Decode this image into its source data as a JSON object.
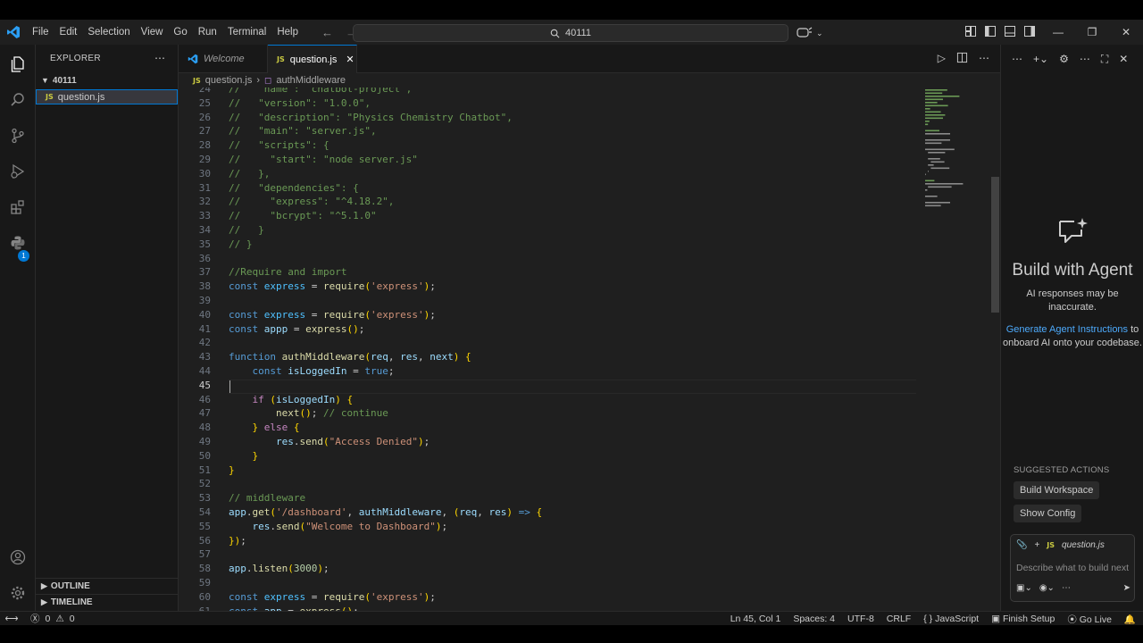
{
  "titlebar": {
    "menu": [
      "File",
      "Edit",
      "Selection",
      "View",
      "Go",
      "Run",
      "Terminal",
      "Help"
    ],
    "search_text": "40111"
  },
  "sidebar": {
    "title": "EXPLORER",
    "folder": "40111",
    "file": "question.js",
    "outline": "OUTLINE",
    "timeline": "TIMELINE",
    "extensions_badge": "1"
  },
  "editor": {
    "tabs": [
      {
        "label": "Welcome",
        "active": false
      },
      {
        "label": "question.js",
        "active": true
      }
    ],
    "breadcrumb": {
      "file": "question.js",
      "symbol": "authMiddleware"
    },
    "cursor_line": 45,
    "lines": [
      {
        "n": 24,
        "text": "//   \"name\": \"chatbot-project\","
      },
      {
        "n": 25,
        "text": "//   \"version\": \"1.0.0\","
      },
      {
        "n": 26,
        "text": "//   \"description\": \"Physics Chemistry Chatbot\","
      },
      {
        "n": 27,
        "text": "//   \"main\": \"server.js\","
      },
      {
        "n": 28,
        "text": "//   \"scripts\": {"
      },
      {
        "n": 29,
        "text": "//     \"start\": \"node server.js\""
      },
      {
        "n": 30,
        "text": "//   },"
      },
      {
        "n": 31,
        "text": "//   \"dependencies\": {"
      },
      {
        "n": 32,
        "text": "//     \"express\": \"^4.18.2\","
      },
      {
        "n": 33,
        "text": "//     \"bcrypt\": \"^5.1.0\""
      },
      {
        "n": 34,
        "text": "//   }"
      },
      {
        "n": 35,
        "text": "// }"
      },
      {
        "n": 36,
        "text": ""
      },
      {
        "n": 37,
        "text": "//Require and import"
      },
      {
        "n": 38,
        "text": "const express = require('express');"
      },
      {
        "n": 39,
        "text": ""
      },
      {
        "n": 40,
        "text": "const express = require('express');"
      },
      {
        "n": 41,
        "text": "const appp = express();"
      },
      {
        "n": 42,
        "text": ""
      },
      {
        "n": 43,
        "text": "function authMiddleware(req, res, next) {"
      },
      {
        "n": 44,
        "text": "    const isLoggedIn = true;"
      },
      {
        "n": 45,
        "text": ""
      },
      {
        "n": 46,
        "text": "    if (isLoggedIn) {"
      },
      {
        "n": 47,
        "text": "        next(); // continue"
      },
      {
        "n": 48,
        "text": "    } else {"
      },
      {
        "n": 49,
        "text": "        res.send(\"Access Denied\");"
      },
      {
        "n": 50,
        "text": "    }"
      },
      {
        "n": 51,
        "text": "}"
      },
      {
        "n": 52,
        "text": ""
      },
      {
        "n": 53,
        "text": "// middleware"
      },
      {
        "n": 54,
        "text": "app.get('/dashboard', authMiddleware, (req, res) => {"
      },
      {
        "n": 55,
        "text": "    res.send(\"Welcome to Dashboard\");"
      },
      {
        "n": 56,
        "text": "});"
      },
      {
        "n": 57,
        "text": ""
      },
      {
        "n": 58,
        "text": "app.listen(3000);"
      },
      {
        "n": 59,
        "text": ""
      },
      {
        "n": 60,
        "text": "const express = require('express');"
      },
      {
        "n": 61,
        "text": "const app = express();"
      }
    ]
  },
  "chat": {
    "title": "Build with Agent",
    "note": "AI responses may be inaccurate.",
    "link_text": "Generate Agent Instructions",
    "link_suffix": " to onboard AI onto your codebase.",
    "suggested_title": "SUGGESTED ACTIONS",
    "suggested": [
      "Build Workspace",
      "Show Config"
    ],
    "context_file": "question.js",
    "input_placeholder": "Describe what to build next"
  },
  "statusbar": {
    "errors": "0",
    "warnings": "0",
    "position": "Ln 45, Col 1",
    "spaces": "Spaces: 4",
    "encoding": "UTF-8",
    "eol": "CRLF",
    "language": "JavaScript",
    "finish_setup": "Finish Setup",
    "go_live": "Go Live"
  },
  "colors": {
    "accent": "#0078d4",
    "editor_bg": "#1f1f1f",
    "comment": "#6a9955",
    "keyword": "#569cd6",
    "string": "#ce9178",
    "function": "#dcdcaa"
  }
}
